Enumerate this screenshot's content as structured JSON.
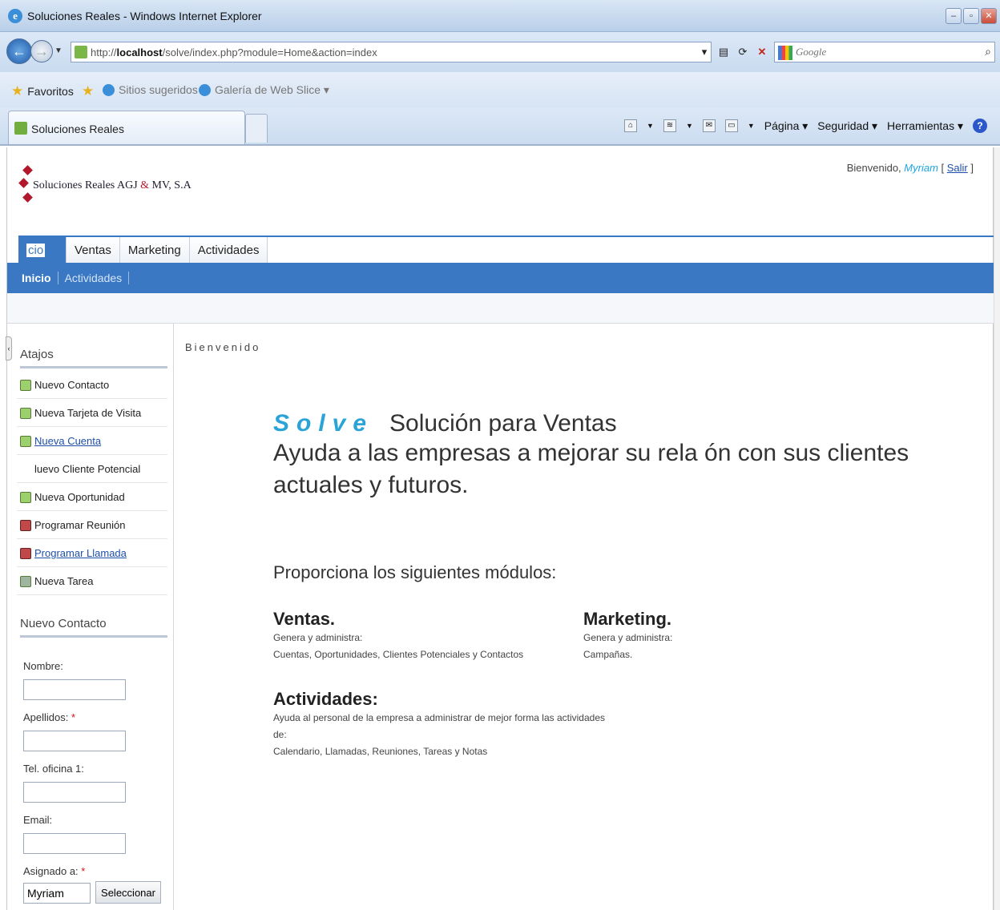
{
  "window": {
    "title": "Soluciones Reales - Windows Internet Explorer"
  },
  "address": {
    "url_prefix": "http://",
    "url_host": "localhost",
    "url_path": "/solve/index.php?module=Home&action=index",
    "search_placeholder": "Google"
  },
  "favorites": {
    "label": "Favoritos",
    "sitios": "Sitios sugeridos ▾",
    "galeria": "Galería de Web Slice ▾"
  },
  "tab": {
    "label": "Soluciones Reales"
  },
  "commandbar": {
    "pagina": "Página ▾",
    "seguridad": "Seguridad ▾",
    "herramientas": "Herramientas ▾"
  },
  "app": {
    "logo_prefix": "Soluciones Reales AGJ ",
    "logo_amp": "&",
    "logo_suffix": " MV, S.A",
    "welcome_prefix": "Bienvenido, ",
    "user": "Myriam",
    "logout_open": " [ ",
    "logout": "Salir",
    "logout_close": " ]"
  },
  "nav": {
    "tabs": [
      "cio",
      "Ventas",
      "Marketing",
      "Actividades"
    ],
    "subnav": [
      "Inicio",
      "Actividades"
    ]
  },
  "sidebar": {
    "shortcuts_title": "Atajos",
    "shortcuts": [
      "Nuevo Contacto",
      "Nueva Tarjeta de Visita",
      "Nueva Cuenta",
      "luevo Cliente Potencial",
      "Nueva Oportunidad",
      "Programar Reunión",
      "Programar Llamada",
      "Nueva Tarea"
    ],
    "form_title": "Nuevo Contacto",
    "fields": {
      "nombre": "Nombre:",
      "apellidos": "Apellidos:",
      "tel": "Tel. oficina 1:",
      "email": "Email:",
      "asignado": "Asignado a:",
      "asignado_value": "Myriam",
      "select_button": "Seleccionar",
      "required_mark": "*"
    }
  },
  "main": {
    "heading": "Bienvenido",
    "brand": "Solve",
    "title": "Solución para Ventas",
    "tagline": "Ayuda a las empresas a mejorar su rela   ón con sus clientes actuales y futuros.",
    "provides": "Proporciona los siguientes módulos:",
    "modules": {
      "ventas": {
        "title": "Ventas.",
        "line1": "Genera y administra:",
        "line2": "Cuentas, Oportunidades, Clientes Potenciales y Contactos"
      },
      "marketing": {
        "title": "Marketing.",
        "line1": "Genera y administra:",
        "line2": "Campañas."
      },
      "actividades": {
        "title": "Actividades:",
        "line1": "Ayuda al personal de la empresa a administrar de mejor forma las actividades de:",
        "line2": "Calendario, Llamadas, Reuniones, Tareas y Notas"
      }
    }
  }
}
